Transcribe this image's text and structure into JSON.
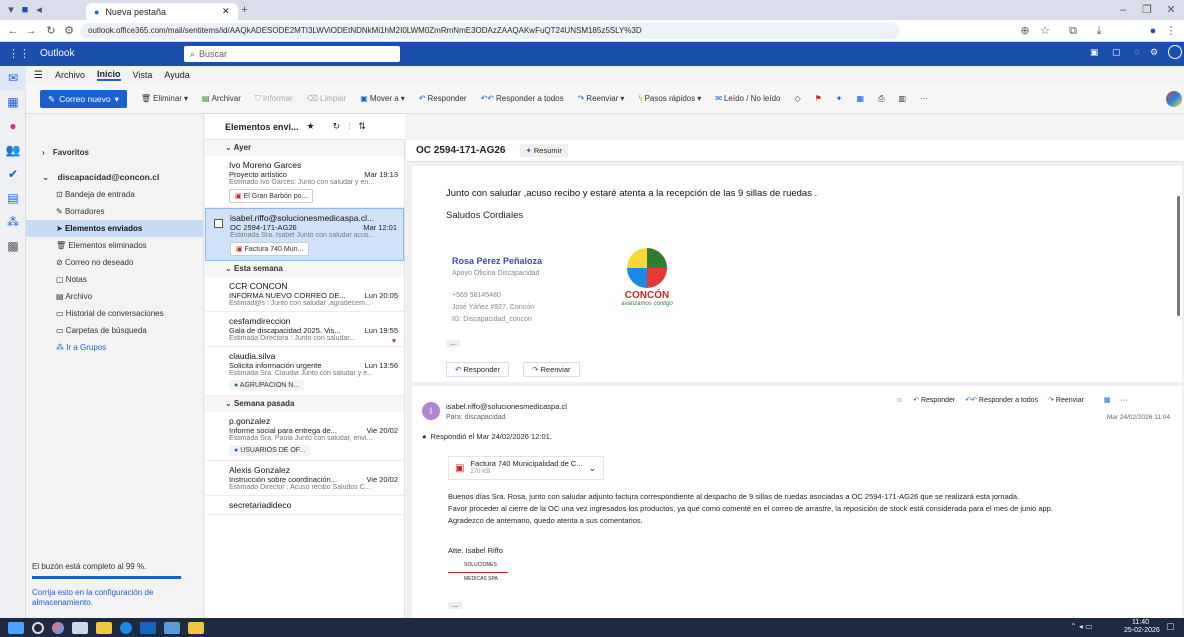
{
  "browser": {
    "tab_title": "Nueva pestaña",
    "url": "outlook.office365.com/mail/sentitems/id/AAQkADESODE2MTI3LWViODEtNDNkMi1hM2I0LWM0ZmRmNmE3ODAzZAAQAKwFuQT24UNSM185z5SLY%3D"
  },
  "outlook": {
    "app_name": "Outlook",
    "search_placeholder": "Buscar"
  },
  "menu": {
    "items": [
      "Archivo",
      "Inicio",
      "Vista",
      "Ayuda"
    ]
  },
  "ribbon": {
    "new_mail": "Correo nuevo",
    "delete": "Eliminar",
    "archive": "Archivar",
    "report": "Informar",
    "sweep": "Limpiar",
    "move_to": "Mover a",
    "reply": "Responder",
    "reply_all": "Responder a todos",
    "forward": "Reenviar",
    "quick_steps": "Pasos rápidos",
    "read_unread": "Leído / No leído"
  },
  "folders": {
    "favorites": "Favoritos",
    "account": "discapacidad@concon.cl",
    "items": [
      "Bandeja de entrada",
      "Borradores",
      "Elementos enviados",
      "Elementos eliminados",
      "Correo no deseado",
      "Notas",
      "Archivo",
      "Historial de conversaciones",
      "Carpetas de búsqueda"
    ],
    "groups": "Ir a Grupos",
    "quota_text": "El buzón está completo al 99 %.",
    "quota_fill": 0.99,
    "quota_link": "Corrija esto en la configuración de almacenamiento."
  },
  "list": {
    "header": "Elementos envi...",
    "groups": {
      "yesterday": "Ayer",
      "this_week": "Esta semana",
      "last_week": "Semana pasada"
    },
    "messages": [
      {
        "from": "Ivo Moreno Garces",
        "subject": "Proyecto artístico",
        "date": "Mar 19:13",
        "preview": "Estimado Ivo Garcés: Junto con saludar y en...",
        "chip": "El Gran Barbón po..."
      },
      {
        "from": "isabel.riffo@solucionesmedicaspa.cl...",
        "subject": "OC 2594-171-AG26",
        "date": "Mar 12:01",
        "preview": "Estimada Sra. Isabel Junto con saludar acus...",
        "chip": "Factura 740 Mun..."
      },
      {
        "from": "CCR CONCON",
        "subject": "INFORMA NUEVO CORREO DE...",
        "date": "Lun 20:05",
        "preview": "Estimad@s : Junto con saludar ,agradecem..."
      },
      {
        "from": "cesfamdireccion",
        "subject": "Gala de discapacidad 2025. Vis...",
        "date": "Lun 19:55",
        "preview": "Estimada Directora : Junto con saludar..."
      },
      {
        "from": "claudia.silva",
        "subject": "Solicita información urgente",
        "date": "Lun 13:56",
        "preview": "Estimada Sra. Claudia Junto con saludar y e...",
        "chip": "AGRUPACION N..."
      },
      {
        "from": "p.gonzalez",
        "subject": "Informe social para entrega de...",
        "date": "Vie 20/02",
        "preview": "Estimada Sra. Paula Junto con saludar, envi...",
        "chip": "USUARIOS DE OF..."
      },
      {
        "from": "Alexis Gonzalez",
        "subject": "Instrucción sobre coordinación...",
        "date": "Vie 20/02",
        "preview": "Estimado Director : Acuso recibo Saludos C..."
      },
      {
        "from": "secretariadideco",
        "subject": "",
        "date": "",
        "preview": ""
      }
    ]
  },
  "reading": {
    "subject": "OC 2594-171-AG26",
    "summarize": "Resumir",
    "reply1": {
      "body": "Junto con saludar ,acuso recibo y estaré atenta a la recepción de las 9 sillas de ruedas .",
      "greeting": "Saludos Cordiales",
      "sig_name": "Rosa Pérez Peñaloza",
      "sig_role": "Apoyo Oficina Discapacidad",
      "sig_phone": "+569 58145480",
      "sig_address": "José Yáñez #927, Concón",
      "sig_social": "IG: Discapacidad_concon",
      "logo_text": "CONCÓN",
      "logo_tag": "avanzamos contigo",
      "ellipsis": "...",
      "reply": "Responder",
      "forward": "Reenviar"
    },
    "original": {
      "avatar": "I",
      "from": "isabel.riffo@solucionesmedicaspa.cl",
      "to": "Para: discapacidad",
      "reply": "Responder",
      "reply_all": "Responder a todos",
      "forward": "Reenviar",
      "date": "Mar 24/02/2026 11:04",
      "replied_note": "Respondió el Mar 24/02/2026 12:01.",
      "attachment_name": "Factura 740 Municipalidad de C...",
      "attachment_size": "270 KB",
      "p1": "Buenos días Sra. Rosa, junto con saludar adjunto factura correspondiente al despacho de 9 sillas de ruedas asociadas a OC 2594-171-AG26 que se realizará esta jornada.",
      "p2": "Favor proceder al cierre de la OC una vez ingresados los productos, ya que como comenté en el correo de arrastre, la reposición de stock está considerada para el mes de junio app.",
      "p3": "Agradezco de antemano, quedo atenta a sus comentarios.",
      "sign": "Atte. Isabel Riffo",
      "logo_l1": "SOLUCIONES",
      "logo_l2": "MÉDICAS SPA",
      "ellipsis": "..."
    }
  },
  "taskbar": {
    "time": "11:40",
    "date": "25-02-2026"
  },
  "colors": {
    "outlook_blue": "#1a4fae",
    "accent": "#1a5fd1",
    "selected_folder": "#c7dcf4",
    "taskbar": "#1d2a3f"
  }
}
